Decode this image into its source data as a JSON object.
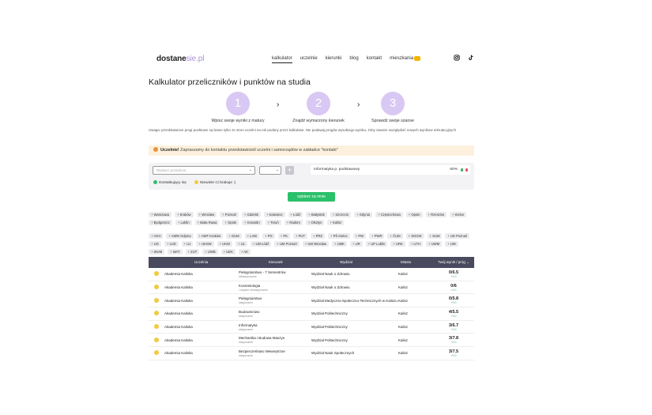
{
  "nav": {
    "logo_main": "dostane",
    "logo_accent": "sie.pl",
    "items": [
      "kalkulator",
      "uczelnie",
      "kierunki",
      "blog",
      "kontakt",
      "mieszkania"
    ],
    "social": [
      "instagram-icon",
      "tiktok-icon"
    ]
  },
  "page_title": "Kalkulator przeliczników i punktów na studia",
  "steps": [
    {
      "num": "1",
      "label": "Wpisz swoje wyniki z matury"
    },
    {
      "num": "2",
      "label": "Znajdź wymarzony kierunek"
    },
    {
      "num": "3",
      "label": "Sprawdź swoje szanse"
    }
  ],
  "note": "Uwaga: przedstawione progi punktowe są brane tylko ze stron uczelni na rok podany przez kalkulator. Nie podawaj progów wysokiego wyniku, żeby zawsze uwzględnić nowych wynikow rekrutacyjnych",
  "info": {
    "bold": "Uczelnie!",
    "text": "Zapraszamy do kontaktu przedstawicieli uczelni i samorządów w zakładce \"kontakt\""
  },
  "form": {
    "select_placeholder": "Wybierz przedmiot",
    "subject": "Informatyka p. podstawowy",
    "subject_pct": "60%",
    "legend_ok": "Dostatkujący się",
    "legend_warn": "Niewiele Ci brakuje :)",
    "submit": "wybierz za mnie"
  },
  "cities": [
    "Warszawa",
    "Kraków",
    "Wrocław",
    "Poznań",
    "Gdańsk",
    "Katowice",
    "Łódź",
    "Białystok",
    "Szczecin",
    "Gdynia",
    "Częstochowa",
    "Opole",
    "Rzeszów",
    "Kielce",
    "Bydgoszcz",
    "Lublin",
    "Biała Rawa",
    "Opole",
    "Koszalin",
    "Toruń",
    "Radom",
    "Olsztyn",
    "Kalisz"
  ],
  "universities": [
    "AGH",
    "AMW Gdynia",
    "AWF Kraków",
    "GUM",
    "LAW",
    "PG",
    "PK",
    "PUT",
    "PRZ",
    "PŚ Kielce",
    "PW",
    "PWR",
    "ČUM",
    "SGGW",
    "SUM",
    "UE Poznań",
    "UG",
    "UJD",
    "UJ",
    "UKSW",
    "UKW",
    "UL",
    "UM Łódź",
    "UM Poznań",
    "UM Wrocław",
    "UMK",
    "UR",
    "UP Lublin",
    "URK",
    "UTH",
    "UWM",
    "UW",
    "WUM",
    "WAT",
    "ZUT",
    "UWB",
    "UEK",
    "AK"
  ],
  "table": {
    "headers": [
      "Uczelnia",
      "Kierunek",
      "Wydział",
      "Miasto",
      "Twój wynik / próg"
    ],
    "rows": [
      {
        "uni": "Akademia Kaliska",
        "course": "Pielęgniarstwo - 7 Semestrów",
        "course_sub": "niestacjonarne",
        "faculty": "Wydział Nauk o Zdrowiu",
        "city": "Kalisz",
        "score": "0/6.5",
        "score_sub": "+0.0"
      },
      {
        "uni": "Akademia Kaliska",
        "course": "Kosmetologia",
        "course_sub": "I stopień niestacjonarne",
        "faculty": "Wydział Nauk o Zdrowiu",
        "city": "Kalisz",
        "score": "0/6",
        "score_sub": "+0.0"
      },
      {
        "uni": "Akademia Kaliska",
        "course": "Pielęgniarstwo",
        "course_sub": "stacjonarne",
        "faculty": "Wydział Medyczno-Społeczno-Technicznych w Kaliszu",
        "city": "Kalisz",
        "score": "0/5.8",
        "score_sub": "+0.0"
      },
      {
        "uni": "Akademia Kaliska",
        "course": "Budownictwo",
        "course_sub": "stacjonarne",
        "faculty": "Wydział Politechniczny",
        "city": "Kalisz",
        "score": "4/5.5",
        "score_sub": "+0.0"
      },
      {
        "uni": "Akademia Kaliska",
        "course": "Informatyka",
        "course_sub": "stacjonarne",
        "faculty": "Wydział Politechniczny",
        "city": "Kalisz",
        "score": "3/6.7",
        "score_sub": "+0.0"
      },
      {
        "uni": "Akademia Kaliska",
        "course": "Mechanika i Budowa Maszyn",
        "course_sub": "stacjonarne",
        "faculty": "Wydział Politechniczny",
        "city": "Kalisz",
        "score": "3/7.8",
        "score_sub": "+0.0"
      },
      {
        "uni": "Akademia Kaliska",
        "course": "Bezpieczeństwo Wewnętrzne",
        "course_sub": "stacjonarne",
        "faculty": "Wydział Nauk Społecznych",
        "city": "Kalisz",
        "score": "3/7.5",
        "score_sub": "+0.0"
      }
    ]
  },
  "colors": {
    "accent": "#d9c8f3",
    "cta": "#2bc06a",
    "header_bg": "#4a4a5e",
    "info_bg": "#fdf1dd",
    "dot_warn": "#f5c842"
  }
}
